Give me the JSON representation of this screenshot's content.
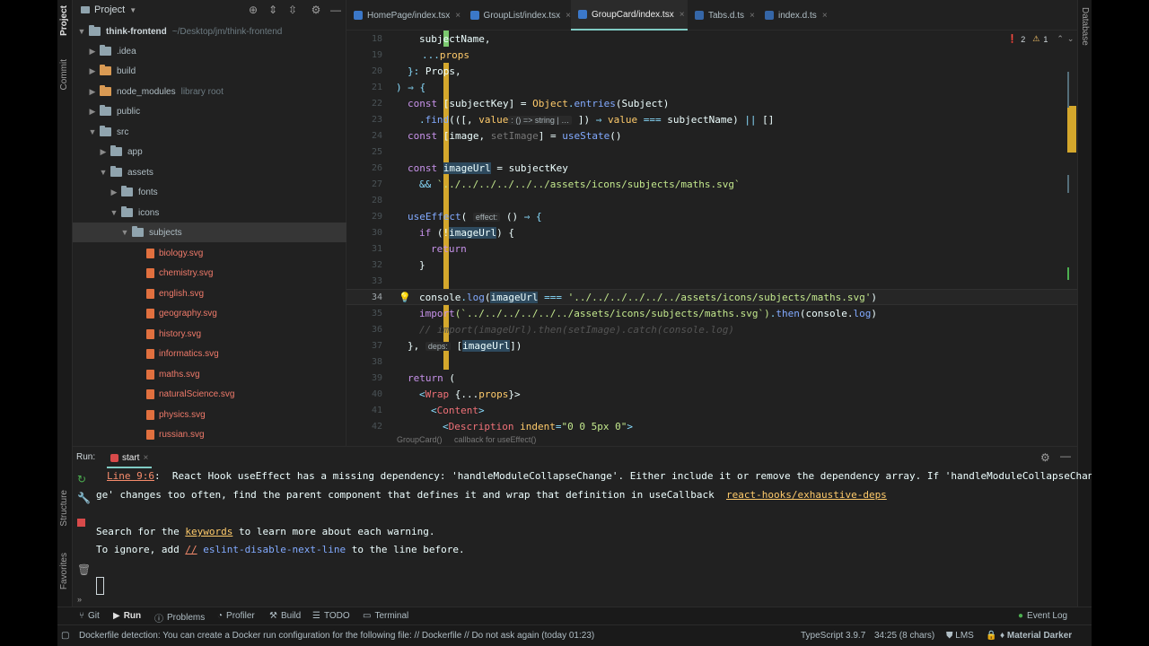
{
  "left_strip": {
    "project": "Project",
    "commit": "Commit",
    "structure": "Structure",
    "favorites": "Favorites"
  },
  "right_strip": {
    "database": "Database"
  },
  "project_panel": {
    "title": "Project",
    "tree": [
      {
        "label": "think-frontend",
        "extra": "~/Desktop/jm/think-frontend"
      },
      {
        "label": ".idea"
      },
      {
        "label": "build"
      },
      {
        "label": "node_modules",
        "extra": "library root"
      },
      {
        "label": "public"
      },
      {
        "label": "src"
      },
      {
        "label": "app"
      },
      {
        "label": "assets"
      },
      {
        "label": "fonts"
      },
      {
        "label": "icons"
      },
      {
        "label": "subjects"
      },
      {
        "label": "biology.svg"
      },
      {
        "label": "chemistry.svg"
      },
      {
        "label": "english.svg"
      },
      {
        "label": "geography.svg"
      },
      {
        "label": "history.svg"
      },
      {
        "label": "informatics.svg"
      },
      {
        "label": "maths.svg"
      },
      {
        "label": "naturalScience.svg"
      },
      {
        "label": "physics.svg"
      },
      {
        "label": "russian.svg"
      }
    ]
  },
  "editor": {
    "tabs": [
      {
        "label": "HomePage/index.tsx"
      },
      {
        "label": "GroupList/index.tsx"
      },
      {
        "label": "GroupCard/index.tsx"
      },
      {
        "label": "Tabs.d.ts"
      },
      {
        "label": "index.d.ts"
      }
    ],
    "inspection": {
      "errors": "2",
      "warnings": "1"
    },
    "line_numbers": [
      "18",
      "19",
      "20",
      "21",
      "22",
      "23",
      "24",
      "25",
      "26",
      "27",
      "28",
      "29",
      "30",
      "31",
      "32",
      "33",
      "34",
      "35",
      "36",
      "37",
      "38",
      "39",
      "40",
      "41",
      "42"
    ],
    "code": {
      "l18": "subjectName,",
      "l19_dots": "...",
      "l19_props": "props",
      "l20_a": "}: ",
      "l20_b": "Props,",
      "l21_a": ") ",
      "l21_b": "⇒ {",
      "l22_const": "const ",
      "l22_b": "[subjectKey] = ",
      "l22_obj": "Object",
      "l22_dot": ".",
      "l22_entries": "entries",
      "l22_c": "(Subject)",
      "l23_dot": ".",
      "l23_find": "find",
      "l23_a": "(([, ",
      "l23_value": "value",
      "l23_hint": ": () => string | …",
      "l23_b": " ]) ",
      "l23_arrow": "⇒",
      "l23_value2": " value ",
      "l23_eq": "===",
      "l23_c": " subjectName) ",
      "l23_or": "||",
      "l23_d": " []",
      "l24_const": "const ",
      "l24_a": "[image, ",
      "l24_set": "setImage",
      "l24_b": "] = ",
      "l24_use": "useState",
      "l24_c": "()",
      "l26_const": "const ",
      "l26_img": "imageUrl",
      "l26_b": " = subjectKey",
      "l27_and": "&&",
      "l27_str": " `../../../../../../assets/icons/subjects/maths.svg`",
      "l29_use": "useEffect",
      "l29_a": "( ",
      "l29_hint": "effect:",
      "l29_b": " () ",
      "l29_arrow": "⇒ {",
      "l30_if": "if ",
      "l30_a": "(!",
      "l30_img": "imageUrl",
      "l30_b": ") {",
      "l31_ret": "return",
      "l32": "}",
      "l34_console": "console",
      "l34_dot": ".",
      "l34_log": "log",
      "l34_a": "(",
      "l34_img": "imageUrl",
      "l34_eq": " === ",
      "l34_str": "'../../../../../../assets/icons/subjects/maths.svg'",
      "l34_b": ")",
      "l35_import": "import",
      "l35_str": "(`../../../../../../assets/icons/subjects/maths.svg`)",
      "l35_dot": ".",
      "l35_then": "then",
      "l35_a": "(console.",
      "l35_log": "log",
      "l35_b": ")",
      "l36": "// import(imageUrl).then(setImage).catch(console.log)",
      "l37_a": "}, ",
      "l37_hint": "deps:",
      "l37_b": " [",
      "l37_img": "imageUrl",
      "l37_c": "])",
      "l39_ret": "return",
      "l39_a": " (",
      "l40_a": "<",
      "l40_tag": "Wrap",
      "l40_b": " {...",
      "l40_props": "props",
      "l40_c": "}>",
      "l41_a": "<",
      "l41_tag": "Content",
      "l41_b": ">",
      "l42_a": "<",
      "l42_tag": "Description",
      "l42_attr": " indent",
      "l42_eq": "=",
      "l42_str": "\"0 0 5px 0\"",
      "l42_b": ">"
    },
    "breadcrumb": [
      "GroupCard()",
      "callback for useEffect()"
    ]
  },
  "run_panel": {
    "label": "Run:",
    "tab": "start",
    "lines": {
      "line_ref": "Line 9:6",
      "msg1": ":  React Hook useEffect has a missing dependency: 'handleModuleCollapseChange'. Either include it or remove the dependency array. If 'handleModuleCollapseChan",
      "msg2": "ge' changes too often, find the parent component that defines it and wrap that definition in useCallback  ",
      "rule": "react-hooks/exhaustive-deps",
      "search_a": "Search for the ",
      "search_kw": "keywords",
      "search_b": " to learn more about each warning.",
      "ignore_a": "To ignore, add ",
      "ignore_slash": "//",
      "ignore_b": " eslint-disable-next-line",
      "ignore_c": " to the line before."
    }
  },
  "tool_windows": [
    {
      "label": "Git"
    },
    {
      "label": "Run"
    },
    {
      "label": "Problems"
    },
    {
      "label": "Profiler"
    },
    {
      "label": "Build"
    },
    {
      "label": "TODO"
    },
    {
      "label": "Terminal"
    }
  ],
  "event_log": "Event Log",
  "status_bar": {
    "message": "Dockerfile detection: You can create a Docker run configuration for the following file: // Dockerfile // Do not ask again (today 01:23)",
    "typescript": "TypeScript 3.9.7",
    "position": "34:25 (8 chars)",
    "lms": "LMS",
    "theme": "Material Darker"
  },
  "colors": {
    "accent": "#80cbc4",
    "gutter_modified": "#d4a72c",
    "error": "#f07178",
    "warning": "#ffcb6b"
  }
}
